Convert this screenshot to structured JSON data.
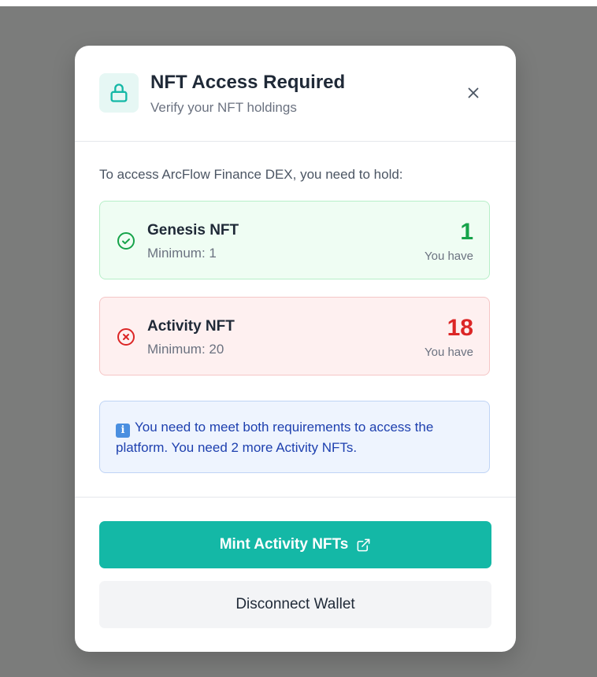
{
  "modal": {
    "title": "NFT Access Required",
    "subtitle": "Verify your NFT holdings",
    "intro": "To access ArcFlow Finance DEX, you need to hold:",
    "requirements": [
      {
        "name": "Genesis NFT",
        "minimum_text": "Minimum: 1",
        "count": "1",
        "have_label": "You have",
        "status": "met",
        "status_color": "#16a34a"
      },
      {
        "name": "Activity NFT",
        "minimum_text": "Minimum: 20",
        "count": "18",
        "have_label": "You have",
        "status": "not-met",
        "status_color": "#dc2626"
      }
    ],
    "info": {
      "icon": "info-icon",
      "text": "You need to meet both requirements to access the platform. You need 2 more Activity NFTs."
    },
    "buttons": {
      "mint_label": "Mint Activity NFTs",
      "disconnect_label": "Disconnect Wallet"
    }
  },
  "colors": {
    "accent": "#14b8a6",
    "success": "#16a34a",
    "danger": "#dc2626",
    "info": "#1e40af"
  }
}
